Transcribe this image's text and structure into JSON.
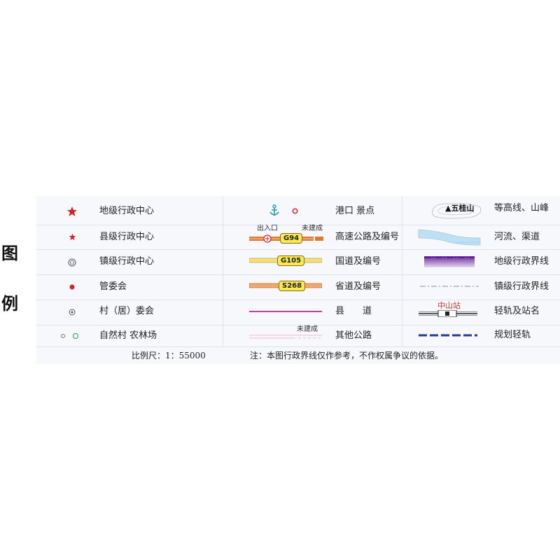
{
  "legend": {
    "title_chars": [
      "图",
      "例"
    ],
    "col1": [
      {
        "label": "地级行政中心",
        "symbol": "star-large-icon"
      },
      {
        "label": "县级行政中心",
        "symbol": "star-small-icon"
      },
      {
        "label": "镇级行政中心",
        "symbol": "double-circle-icon"
      },
      {
        "label": "管委会",
        "symbol": "red-dot-icon"
      },
      {
        "label": "村（居）委会",
        "symbol": "dotted-circle-icon"
      },
      {
        "label": "自然村 农林场",
        "symbol": "small-circles-icon"
      }
    ],
    "col2": [
      {
        "label": "港口 景点",
        "symbol": "anchor-and-scenic-icon"
      },
      {
        "label": "高速公路及编号",
        "badge": "G94",
        "left_note": "出入口",
        "right_note": "未建成"
      },
      {
        "label": "国道及编号",
        "badge": "G105"
      },
      {
        "label": "省道及编号",
        "badge": "S268"
      },
      {
        "label": "县　　道",
        "symbol": "magenta-line"
      },
      {
        "label": "其他公路",
        "right_note": "未建成"
      }
    ],
    "col3": [
      {
        "label": "等高线、山峰",
        "peak": "▲五桂山"
      },
      {
        "label": "河流、渠道",
        "symbol": "river-symbol"
      },
      {
        "label": "地级行政界线",
        "symbol": "purple-boundary"
      },
      {
        "label": "镇级行政界线",
        "symbol": "dashed-boundary"
      },
      {
        "label": "轻轨及站名",
        "station": "中山站"
      },
      {
        "label": "规划轻轨",
        "symbol": "blue-dashed-line"
      }
    ],
    "scale": "比例尺：1：55000",
    "note": "注：本图行政界线仅作参考，不作权属争议的依据。"
  },
  "colors": {
    "star": "#d8202a",
    "expressway": "#e8782a",
    "national_road": "#f3e07a",
    "provincial_road": "#f2a86c",
    "county_road": "#d23a9a",
    "river": "#bfe0f3",
    "boundary": "#8a3bb0",
    "rail": "#1f3a9b"
  }
}
